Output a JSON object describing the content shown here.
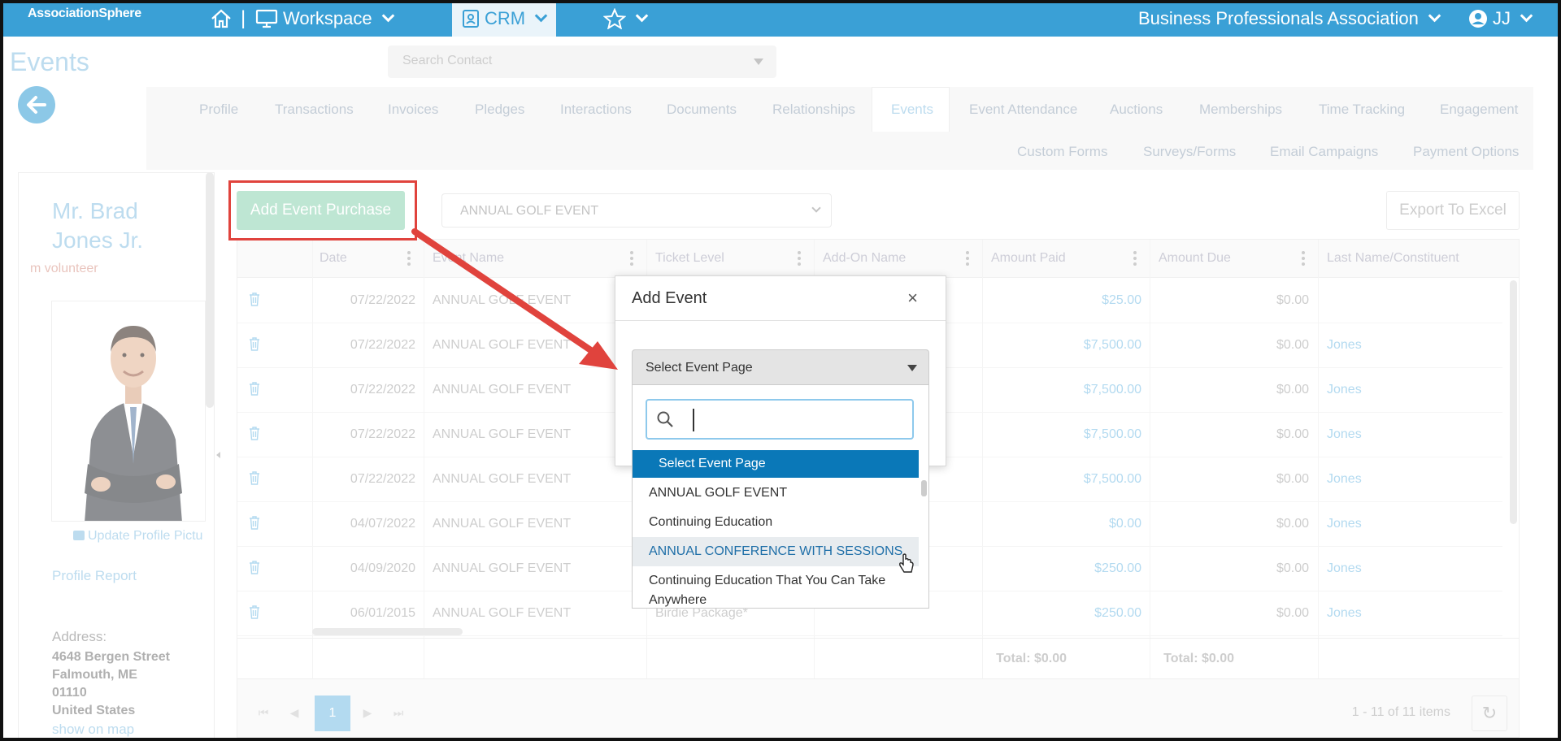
{
  "topbar": {
    "logo": "AssociationSphere",
    "workspace_label": "Workspace",
    "crm_label": "CRM",
    "org_name": "Business Professionals Association",
    "user_initials": "JJ",
    "color": "#3aa0d6"
  },
  "page": {
    "title": "Events",
    "search_placeholder": "Search Contact"
  },
  "tabs": {
    "row1": [
      "Profile",
      "Transactions",
      "Invoices",
      "Pledges",
      "Interactions",
      "Documents",
      "Relationships",
      "Events",
      "Event Attendance",
      "Auctions",
      "Memberships",
      "Time Tracking",
      "Engagement"
    ],
    "row2": [
      "Custom Forms",
      "Surveys/Forms",
      "Email Campaigns",
      "Payment Options"
    ],
    "active": "Events"
  },
  "profile": {
    "name": "Mr. Brad Jones Jr.",
    "tag": "m volunteer",
    "update_picture": "Update Profile Pictu",
    "profile_report": "Profile Report",
    "address_label": "Address:",
    "address_lines": [
      "4648 Bergen Street",
      "Falmouth, ME",
      "01110",
      "United States"
    ],
    "show_on_map": "show on map"
  },
  "toolbar": {
    "add_button": "Add Event Purchase",
    "event_filter": "ANNUAL GOLF EVENT",
    "export_button": "Export To Excel"
  },
  "grid": {
    "columns": [
      "Date",
      "Event Name",
      "Ticket Level",
      "Add-On Name",
      "Amount Paid",
      "Amount Due",
      "Last Name/Constituent"
    ],
    "rows": [
      {
        "date": "07/22/2022",
        "event": "ANNUAL GOLF EVENT",
        "ticket": "",
        "addon": "",
        "paid": "$25.00",
        "due": "$0.00",
        "last": ""
      },
      {
        "date": "07/22/2022",
        "event": "ANNUAL GOLF EVENT",
        "ticket": "",
        "addon": "",
        "paid": "$7,500.00",
        "due": "$0.00",
        "last": "Jones"
      },
      {
        "date": "07/22/2022",
        "event": "ANNUAL GOLF EVENT",
        "ticket": "",
        "addon": "",
        "paid": "$7,500.00",
        "due": "$0.00",
        "last": "Jones"
      },
      {
        "date": "07/22/2022",
        "event": "ANNUAL GOLF EVENT",
        "ticket": "",
        "addon": "",
        "paid": "$7,500.00",
        "due": "$0.00",
        "last": "Jones"
      },
      {
        "date": "07/22/2022",
        "event": "ANNUAL GOLF EVENT",
        "ticket": "",
        "addon": "",
        "paid": "$7,500.00",
        "due": "$0.00",
        "last": "Jones"
      },
      {
        "date": "04/07/2022",
        "event": "ANNUAL GOLF EVENT",
        "ticket": "",
        "addon": "",
        "paid": "$0.00",
        "due": "$0.00",
        "last": "Jones"
      },
      {
        "date": "04/09/2020",
        "event": "ANNUAL GOLF EVENT",
        "ticket": "",
        "addon": "",
        "paid": "$250.00",
        "due": "$0.00",
        "last": "Jones"
      },
      {
        "date": "06/01/2015",
        "event": "ANNUAL GOLF EVENT",
        "ticket": "Birdie Package*",
        "addon": "",
        "paid": "$250.00",
        "due": "$0.00",
        "last": "Jones"
      }
    ],
    "total_paid": "Total: $0.00",
    "total_due": "Total: $0.00",
    "current_page": "1",
    "items_summary": "1 - 11 of 11 items"
  },
  "modal": {
    "title": "Add Event",
    "close": "×",
    "select_placeholder": "Select Event Page",
    "options": [
      "Select Event Page",
      "ANNUAL GOLF EVENT",
      "Continuing Education",
      "ANNUAL CONFERENCE WITH SESSIONS",
      "Continuing Education That You Can Take Anywhere"
    ],
    "hovered_option": "ANNUAL CONFERENCE WITH SESSIONS"
  },
  "annotation": {
    "highlight_color": "#e0433d",
    "arrow_color": "#e0433d"
  }
}
